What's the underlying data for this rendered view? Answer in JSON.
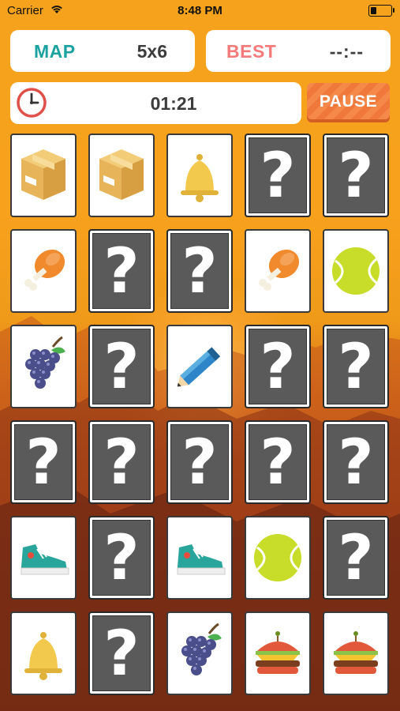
{
  "status_bar": {
    "carrier": "Carrier",
    "time": "8:48 PM"
  },
  "header": {
    "map_label": "MAP",
    "map_value": "5x6",
    "best_label": "BEST",
    "best_value": "--:--",
    "timer_value": "01:21",
    "pause_label": "PAUSE"
  },
  "icons": {
    "clock": "clock-icon",
    "wifi": "wifi-icon",
    "battery": "battery-icon"
  },
  "colors": {
    "background": "#f6a21c",
    "map_label": "#1ba2a0",
    "best_label": "#f47a7a",
    "pause": "#f4894a",
    "card_back": "#5a5a5a"
  },
  "board": {
    "cols": 5,
    "rows": 6,
    "hidden_symbol": "?",
    "cards": [
      [
        "box",
        "box",
        "bell",
        "hidden",
        "hidden"
      ],
      [
        "chicken",
        "hidden",
        "hidden",
        "chicken",
        "tennis-ball"
      ],
      [
        "grapes",
        "hidden",
        "pencil",
        "hidden",
        "hidden"
      ],
      [
        "hidden",
        "hidden",
        "hidden",
        "hidden",
        "hidden"
      ],
      [
        "sneaker",
        "hidden",
        "sneaker",
        "tennis-ball",
        "hidden"
      ],
      [
        "bell",
        "hidden",
        "grapes",
        "burger",
        "burger"
      ]
    ]
  }
}
